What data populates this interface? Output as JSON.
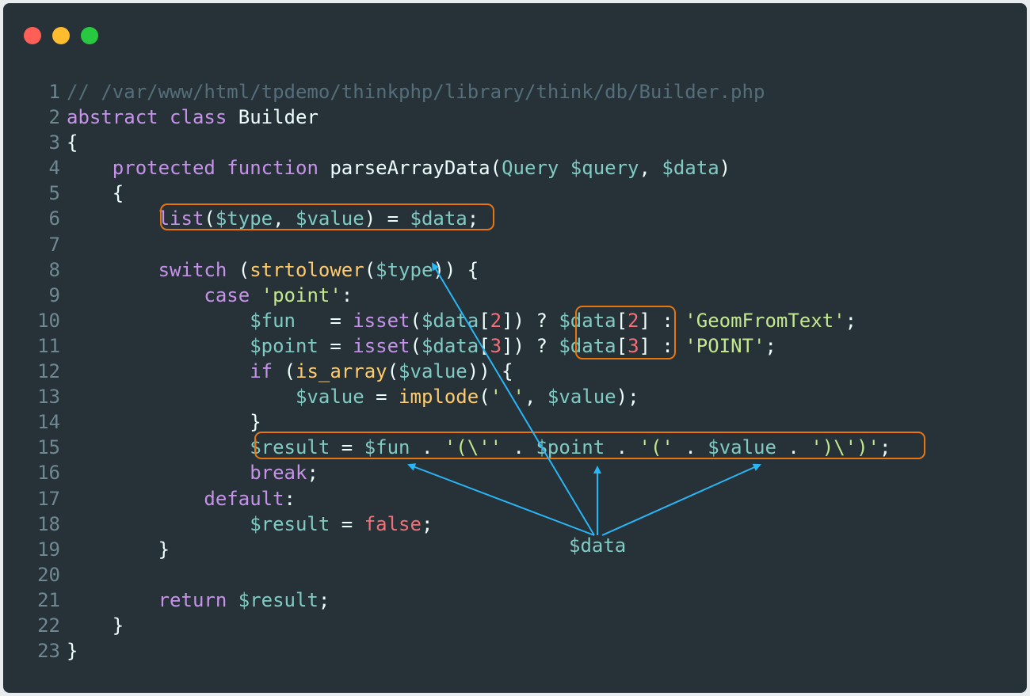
{
  "window": {
    "controls": [
      {
        "name": "close",
        "color": "#ff5f57"
      },
      {
        "name": "minimize",
        "color": "#febc2e"
      },
      {
        "name": "maximize",
        "color": "#28c840"
      }
    ]
  },
  "code": {
    "lines": [
      {
        "n": "1",
        "tokens": [
          {
            "t": "// /var/www/html/tpdemo/thinkphp/library/think/db/Builder.php",
            "c": "cm"
          }
        ]
      },
      {
        "n": "2",
        "tokens": [
          {
            "t": "abstract ",
            "c": "kw"
          },
          {
            "t": "class ",
            "c": "kw"
          },
          {
            "t": "Builder",
            "c": "id"
          }
        ]
      },
      {
        "n": "3",
        "tokens": [
          {
            "t": "{",
            "c": "pn"
          }
        ]
      },
      {
        "n": "4",
        "tokens": [
          {
            "t": "    ",
            "c": "pn"
          },
          {
            "t": "protected ",
            "c": "kw"
          },
          {
            "t": "function ",
            "c": "kw"
          },
          {
            "t": "parseArrayData",
            "c": "id"
          },
          {
            "t": "(",
            "c": "pn"
          },
          {
            "t": "Query ",
            "c": "ty"
          },
          {
            "t": "$query",
            "c": "va"
          },
          {
            "t": ", ",
            "c": "pn"
          },
          {
            "t": "$data",
            "c": "va"
          },
          {
            "t": ")",
            "c": "pn"
          }
        ]
      },
      {
        "n": "5",
        "tokens": [
          {
            "t": "    {",
            "c": "pn"
          }
        ]
      },
      {
        "n": "6",
        "tokens": [
          {
            "t": "        ",
            "c": "pn"
          },
          {
            "t": "list",
            "c": "kw"
          },
          {
            "t": "(",
            "c": "pn"
          },
          {
            "t": "$type",
            "c": "va"
          },
          {
            "t": ", ",
            "c": "pn"
          },
          {
            "t": "$value",
            "c": "va"
          },
          {
            "t": ") = ",
            "c": "pn"
          },
          {
            "t": "$data",
            "c": "va"
          },
          {
            "t": ";",
            "c": "pn"
          }
        ]
      },
      {
        "n": "7",
        "tokens": []
      },
      {
        "n": "8",
        "tokens": [
          {
            "t": "        ",
            "c": "pn"
          },
          {
            "t": "switch ",
            "c": "kw"
          },
          {
            "t": "(",
            "c": "pn"
          },
          {
            "t": "strtolower",
            "c": "fy"
          },
          {
            "t": "(",
            "c": "pn"
          },
          {
            "t": "$type",
            "c": "va"
          },
          {
            "t": ")) {",
            "c": "pn"
          }
        ]
      },
      {
        "n": "9",
        "tokens": [
          {
            "t": "            ",
            "c": "pn"
          },
          {
            "t": "case ",
            "c": "kw"
          },
          {
            "t": "'point'",
            "c": "st"
          },
          {
            "t": ":",
            "c": "pn"
          }
        ]
      },
      {
        "n": "10",
        "tokens": [
          {
            "t": "                ",
            "c": "pn"
          },
          {
            "t": "$fun",
            "c": "va"
          },
          {
            "t": "   = ",
            "c": "pn"
          },
          {
            "t": "isset",
            "c": "kw"
          },
          {
            "t": "(",
            "c": "pn"
          },
          {
            "t": "$data",
            "c": "va"
          },
          {
            "t": "[",
            "c": "pn"
          },
          {
            "t": "2",
            "c": "nu"
          },
          {
            "t": "]) ? ",
            "c": "pn"
          },
          {
            "t": "$data",
            "c": "va"
          },
          {
            "t": "[",
            "c": "pn"
          },
          {
            "t": "2",
            "c": "nu"
          },
          {
            "t": "] : ",
            "c": "pn"
          },
          {
            "t": "'GeomFromText'",
            "c": "st"
          },
          {
            "t": ";",
            "c": "pn"
          }
        ]
      },
      {
        "n": "11",
        "tokens": [
          {
            "t": "                ",
            "c": "pn"
          },
          {
            "t": "$point",
            "c": "va"
          },
          {
            "t": " = ",
            "c": "pn"
          },
          {
            "t": "isset",
            "c": "kw"
          },
          {
            "t": "(",
            "c": "pn"
          },
          {
            "t": "$data",
            "c": "va"
          },
          {
            "t": "[",
            "c": "pn"
          },
          {
            "t": "3",
            "c": "nu"
          },
          {
            "t": "]) ? ",
            "c": "pn"
          },
          {
            "t": "$data",
            "c": "va"
          },
          {
            "t": "[",
            "c": "pn"
          },
          {
            "t": "3",
            "c": "nu"
          },
          {
            "t": "] : ",
            "c": "pn"
          },
          {
            "t": "'POINT'",
            "c": "st"
          },
          {
            "t": ";",
            "c": "pn"
          }
        ]
      },
      {
        "n": "12",
        "tokens": [
          {
            "t": "                ",
            "c": "pn"
          },
          {
            "t": "if ",
            "c": "kw"
          },
          {
            "t": "(",
            "c": "pn"
          },
          {
            "t": "is_array",
            "c": "fy"
          },
          {
            "t": "(",
            "c": "pn"
          },
          {
            "t": "$value",
            "c": "va"
          },
          {
            "t": ")) {",
            "c": "pn"
          }
        ]
      },
      {
        "n": "13",
        "tokens": [
          {
            "t": "                    ",
            "c": "pn"
          },
          {
            "t": "$value",
            "c": "va"
          },
          {
            "t": " = ",
            "c": "pn"
          },
          {
            "t": "implode",
            "c": "fy"
          },
          {
            "t": "(",
            "c": "pn"
          },
          {
            "t": "' '",
            "c": "st"
          },
          {
            "t": ", ",
            "c": "pn"
          },
          {
            "t": "$value",
            "c": "va"
          },
          {
            "t": ");",
            "c": "pn"
          }
        ]
      },
      {
        "n": "14",
        "tokens": [
          {
            "t": "                }",
            "c": "pn"
          }
        ]
      },
      {
        "n": "15",
        "tokens": [
          {
            "t": "                ",
            "c": "pn"
          },
          {
            "t": "$result",
            "c": "va"
          },
          {
            "t": " = ",
            "c": "pn"
          },
          {
            "t": "$fun",
            "c": "va"
          },
          {
            "t": " . ",
            "c": "pn"
          },
          {
            "t": "'(\\''",
            "c": "st"
          },
          {
            "t": " . ",
            "c": "pn"
          },
          {
            "t": "$point",
            "c": "va"
          },
          {
            "t": " . ",
            "c": "pn"
          },
          {
            "t": "'('",
            "c": "st"
          },
          {
            "t": " . ",
            "c": "pn"
          },
          {
            "t": "$value",
            "c": "va"
          },
          {
            "t": " . ",
            "c": "pn"
          },
          {
            "t": "')\\')'",
            "c": "st"
          },
          {
            "t": ";",
            "c": "pn"
          }
        ]
      },
      {
        "n": "16",
        "tokens": [
          {
            "t": "                ",
            "c": "pn"
          },
          {
            "t": "break",
            "c": "kw"
          },
          {
            "t": ";",
            "c": "pn"
          }
        ]
      },
      {
        "n": "17",
        "tokens": [
          {
            "t": "            ",
            "c": "pn"
          },
          {
            "t": "default",
            "c": "kw"
          },
          {
            "t": ":",
            "c": "pn"
          }
        ]
      },
      {
        "n": "18",
        "tokens": [
          {
            "t": "                ",
            "c": "pn"
          },
          {
            "t": "$result",
            "c": "va"
          },
          {
            "t": " = ",
            "c": "pn"
          },
          {
            "t": "false",
            "c": "bo"
          },
          {
            "t": ";",
            "c": "pn"
          }
        ]
      },
      {
        "n": "19",
        "tokens": [
          {
            "t": "        }",
            "c": "pn"
          }
        ]
      },
      {
        "n": "20",
        "tokens": []
      },
      {
        "n": "21",
        "tokens": [
          {
            "t": "        ",
            "c": "pn"
          },
          {
            "t": "return ",
            "c": "kw"
          },
          {
            "t": "$result",
            "c": "va"
          },
          {
            "t": ";",
            "c": "pn"
          }
        ]
      },
      {
        "n": "22",
        "tokens": [
          {
            "t": "    }",
            "c": "pn"
          }
        ]
      },
      {
        "n": "23",
        "tokens": [
          {
            "t": "}",
            "c": "pn"
          }
        ]
      }
    ]
  },
  "annotation": {
    "label": "$data",
    "box_color": "#e8760e",
    "arrow_color": "#29b6f6"
  }
}
